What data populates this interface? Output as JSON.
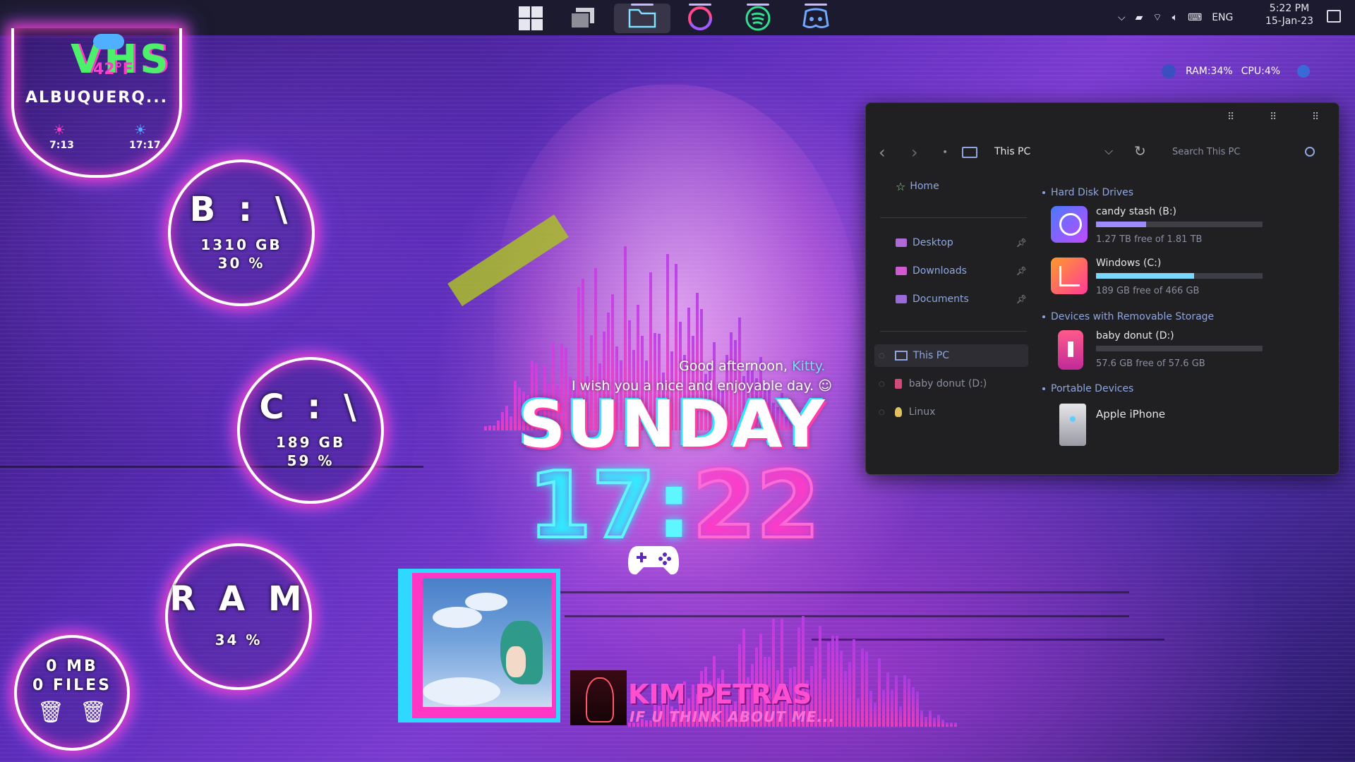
{
  "colors": {
    "accent_pink": "#ff3cc8",
    "accent_cyan": "#2fe6ff",
    "panel_bg": "#202023",
    "bar_candy": "#9c8cff",
    "bar_windows": "#7ad8ff"
  },
  "taskbar": {
    "icons": [
      "windows-start-icon",
      "task-view-icon",
      "file-explorer-icon",
      "cortana-icon",
      "spotify-icon",
      "discord-icon"
    ],
    "language": "ENG",
    "time": "5:22 PM",
    "date": "15-Jan-23"
  },
  "weather": {
    "overlay": "VHS",
    "overlay_small": "42°F",
    "city": "ALBUQUERQ...",
    "sunrise": "7:13",
    "sunset": "17:17"
  },
  "drive_b": {
    "label": "B : \\",
    "size": "1310 GB",
    "percent": "30 %"
  },
  "drive_c": {
    "label": "C : \\",
    "size": "189 GB",
    "percent": "59 %"
  },
  "ram": {
    "label": "R A M",
    "percent": "34 %"
  },
  "recycle": {
    "size": "0 MB",
    "files": "0 FILES"
  },
  "greeting": {
    "line1": "Good afternoon,",
    "name": "Kitty.",
    "line2": "I wish you a nice and enjoyable day.",
    "smile": "☺"
  },
  "day": "SUNDAY",
  "clock": {
    "hours": "17",
    "sep": ":",
    "minutes": "22"
  },
  "music": {
    "artist": "KIM PETRAS",
    "track": "IF U THINK ABOUT ME..."
  },
  "stats": {
    "ram": "RAM:34%",
    "cpu": "CPU:4%"
  },
  "explorer": {
    "location": "This PC",
    "search_placeholder": "Search This PC",
    "nav": {
      "home": "Home",
      "desktop": "Desktop",
      "downloads": "Downloads",
      "documents": "Documents",
      "this_pc": "This PC",
      "baby_donut": "baby donut (D:)",
      "linux": "Linux"
    },
    "sections": {
      "hdd": "Hard Disk Drives",
      "removable": "Devices with Removable Storage",
      "portable": "Portable Devices"
    },
    "drives": [
      {
        "name": "candy stash (B:)",
        "free": "1.27 TB free of 1.81 TB",
        "used_fraction": 0.3
      },
      {
        "name": "Windows (C:)",
        "free": "189 GB free of 466 GB",
        "used_fraction": 0.59
      },
      {
        "name": "baby donut (D:)",
        "free": "57.6 GB free of 57.6 GB",
        "used_fraction": 0.0
      }
    ],
    "portable": {
      "name": "Apple iPhone"
    }
  }
}
